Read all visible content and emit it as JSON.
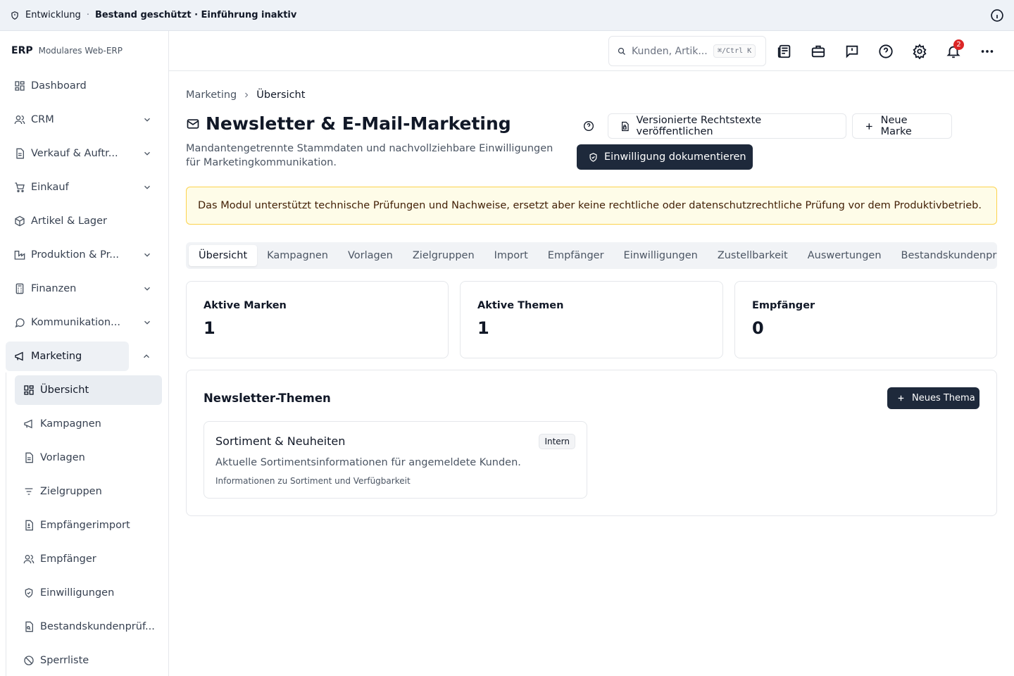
{
  "topbar": {
    "env": "Entwicklung",
    "separator": "·",
    "status": "Bestand geschützt · Einführung inaktiv"
  },
  "brand": {
    "logo": "ERP",
    "subtitle": "Modulares Web-ERP"
  },
  "sidebar": {
    "items": [
      {
        "label": "Dashboard"
      },
      {
        "label": "CRM"
      },
      {
        "label": "Verkauf & Auftr..."
      },
      {
        "label": "Einkauf"
      },
      {
        "label": "Artikel & Lager"
      },
      {
        "label": "Produktion & Pr..."
      },
      {
        "label": "Finanzen"
      },
      {
        "label": "Kommunikation..."
      },
      {
        "label": "Marketing"
      }
    ],
    "subitems": [
      {
        "label": "Übersicht"
      },
      {
        "label": "Kampagnen"
      },
      {
        "label": "Vorlagen"
      },
      {
        "label": "Zielgruppen"
      },
      {
        "label": "Empfängerimport"
      },
      {
        "label": "Empfänger"
      },
      {
        "label": "Einwilligungen"
      },
      {
        "label": "Bestandskundenprüf..."
      },
      {
        "label": "Sperrliste"
      }
    ]
  },
  "header": {
    "search_placeholder": "Kunden, Artik...",
    "shortcut": "⌘/Ctrl K",
    "notification_count": "2"
  },
  "breadcrumb": {
    "parent": "Marketing",
    "current": "Übersicht"
  },
  "page": {
    "title": "Newsletter & E-Mail-Marketing",
    "subtitle": "Mandantengetrennte Stammdaten und nachvollziehbare Einwilligungen für Marketingkommunikation.",
    "btn_publish": "Versionierte Rechtstexte veröffentlichen",
    "btn_new_brand": "Neue Marke",
    "btn_consent": "Einwilligung dokumentieren",
    "alert": "Das Modul unterstützt technische Prüfungen und Nachweise, ersetzt aber keine rechtliche oder datenschutzrechtliche Prüfung vor dem Produktivbetrieb."
  },
  "tabs": [
    "Übersicht",
    "Kampagnen",
    "Vorlagen",
    "Zielgruppen",
    "Import",
    "Empfänger",
    "Einwilligungen",
    "Zustellbarkeit",
    "Auswertungen",
    "Bestandskundenprüfung"
  ],
  "stats": [
    {
      "label": "Aktive Marken",
      "value": "1"
    },
    {
      "label": "Aktive Themen",
      "value": "1"
    },
    {
      "label": "Empfänger",
      "value": "0"
    }
  ],
  "topics": {
    "title": "Newsletter-Themen",
    "btn_new": "Neues Thema",
    "cards": [
      {
        "title": "Sortiment & Neuheiten",
        "badge": "Intern",
        "description": "Aktuelle Sortimentsinformationen für angemeldete Kunden.",
        "info": "Informationen zu Sortiment und Verfügbarkeit"
      }
    ]
  }
}
